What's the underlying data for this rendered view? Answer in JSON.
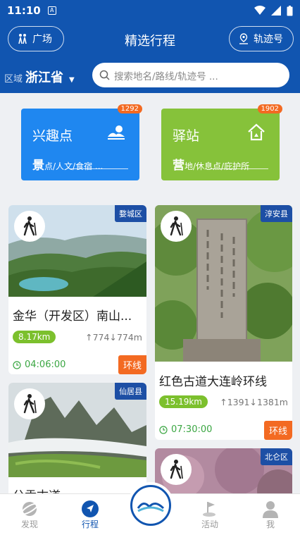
{
  "status": {
    "time": "11:10"
  },
  "header": {
    "title": "精选行程",
    "left_button": "广场",
    "right_button": "轨迹号",
    "region_label": "区域",
    "region_value": "浙江省",
    "search_placeholder": "搜索地名/路线/轨迹号 ..."
  },
  "categories": [
    {
      "title": "兴趣点",
      "badge": "1292",
      "sub_big": "景",
      "sub_rest": "点/人文/食宿 ...",
      "color": "#1f87f0"
    },
    {
      "title": "驿站",
      "badge": "1902",
      "sub_big": "营",
      "sub_rest": "地/休息点/庇护所",
      "color": "#86c23a"
    }
  ],
  "routes": [
    {
      "area": "婺城区",
      "name": "金华（开发区）南山...",
      "km": "8.17km",
      "up": "774",
      "down": "774m",
      "duration": "04:06:00",
      "type": "环线"
    },
    {
      "area": "淳安县",
      "name": "红色古道大连岭环线",
      "km": "15.19km",
      "up": "1391",
      "down": "1381m",
      "duration": "07:30:00",
      "type": "环线"
    },
    {
      "area": "仙居县",
      "name": "公盂古道"
    },
    {
      "area": "北仑区"
    }
  ],
  "tabs": [
    {
      "label": "发现"
    },
    {
      "label": "行程"
    },
    {
      "label": "活动"
    },
    {
      "label": "我"
    }
  ],
  "colors": {
    "primary": "#1155b0",
    "accent": "#f36a22",
    "green": "#7cc02d"
  }
}
